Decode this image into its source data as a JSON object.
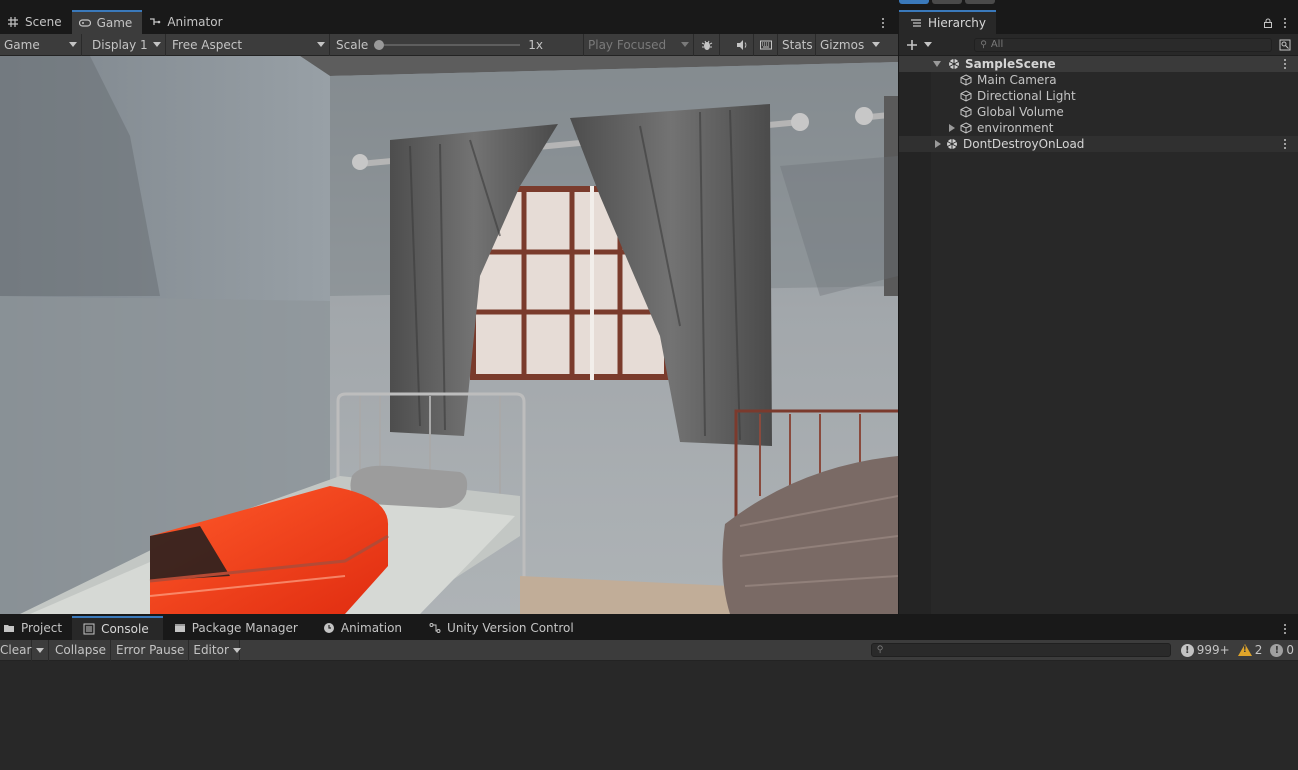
{
  "top_tabs": [
    {
      "label": "Scene",
      "icon": "grid-icon"
    },
    {
      "label": "Game",
      "icon": "gamepad-icon",
      "active": true
    },
    {
      "label": "Animator",
      "icon": "animator-icon"
    }
  ],
  "game_toolbar": {
    "mode": "Game",
    "display": "Display 1",
    "aspect": "Free Aspect",
    "scale_label": "Scale",
    "scale_value": "1x",
    "play_mode": "Play Focused",
    "stats": "Stats",
    "gizmos": "Gizmos"
  },
  "hierarchy": {
    "tab_label": "Hierarchy",
    "search_placeholder": "All",
    "scene_name": "SampleScene",
    "items": [
      {
        "label": "Main Camera"
      },
      {
        "label": "Directional Light"
      },
      {
        "label": "Global Volume"
      },
      {
        "label": "environment",
        "collapsed": true
      }
    ],
    "dont_destroy": "DontDestroyOnLoad"
  },
  "bottom_tabs": [
    {
      "label": "Project",
      "icon": "folder-icon"
    },
    {
      "label": "Console",
      "icon": "console-icon",
      "active": true
    },
    {
      "label": "Package Manager",
      "icon": "package-icon"
    },
    {
      "label": "Animation",
      "icon": "clock-icon"
    },
    {
      "label": "Unity Version Control",
      "icon": "branch-icon"
    }
  ],
  "console_toolbar": {
    "clear": "Clear",
    "collapse": "Collapse",
    "error_pause": "Error Pause",
    "editor": "Editor",
    "log_count": "999+",
    "warning_count": "2",
    "error_count": "0"
  },
  "colors": {
    "accent": "#3a79bb",
    "panel": "#282828",
    "toolbar": "#3c3c3c",
    "warning": "#e0a52a",
    "suitcase": "#ff3a1a"
  }
}
